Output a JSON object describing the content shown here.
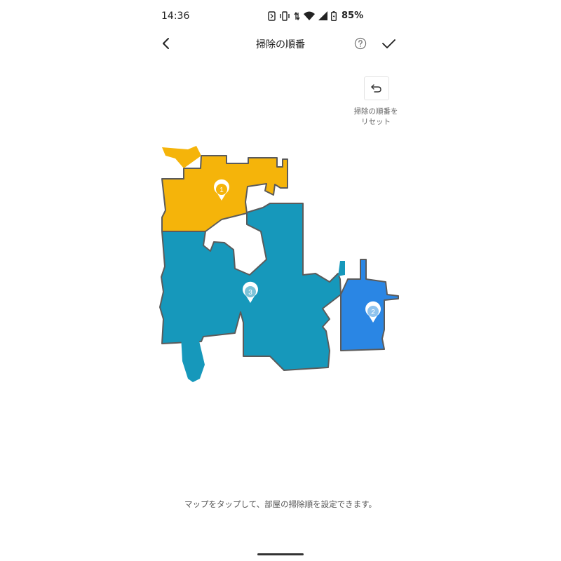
{
  "status_bar": {
    "time": "14:36",
    "battery": "85%",
    "icons": [
      "nfc-icon",
      "vibrate-icon",
      "data-arrows-icon",
      "wifi-icon",
      "signal-icon",
      "battery-icon"
    ]
  },
  "header": {
    "title": "掃除の順番",
    "back_icon": "chevron-left-icon",
    "help_icon": "help-circle-icon",
    "confirm_icon": "checkmark-icon"
  },
  "reset": {
    "label_line1": "掃除の順番を",
    "label_line2": "リセット",
    "icon": "undo-arrow-icon"
  },
  "map": {
    "rooms": [
      {
        "order": "1",
        "color": "#f5b40a"
      },
      {
        "order": "2",
        "color": "#2a86e4"
      },
      {
        "order": "3",
        "color": "#1698bb"
      }
    ],
    "wall_color": "#5b5b5b"
  },
  "hint": "マップをタップして、部屋の掃除順を設定できます。",
  "colors": {
    "background": "#ffffff",
    "text": "#222222",
    "muted_text": "#666666"
  }
}
